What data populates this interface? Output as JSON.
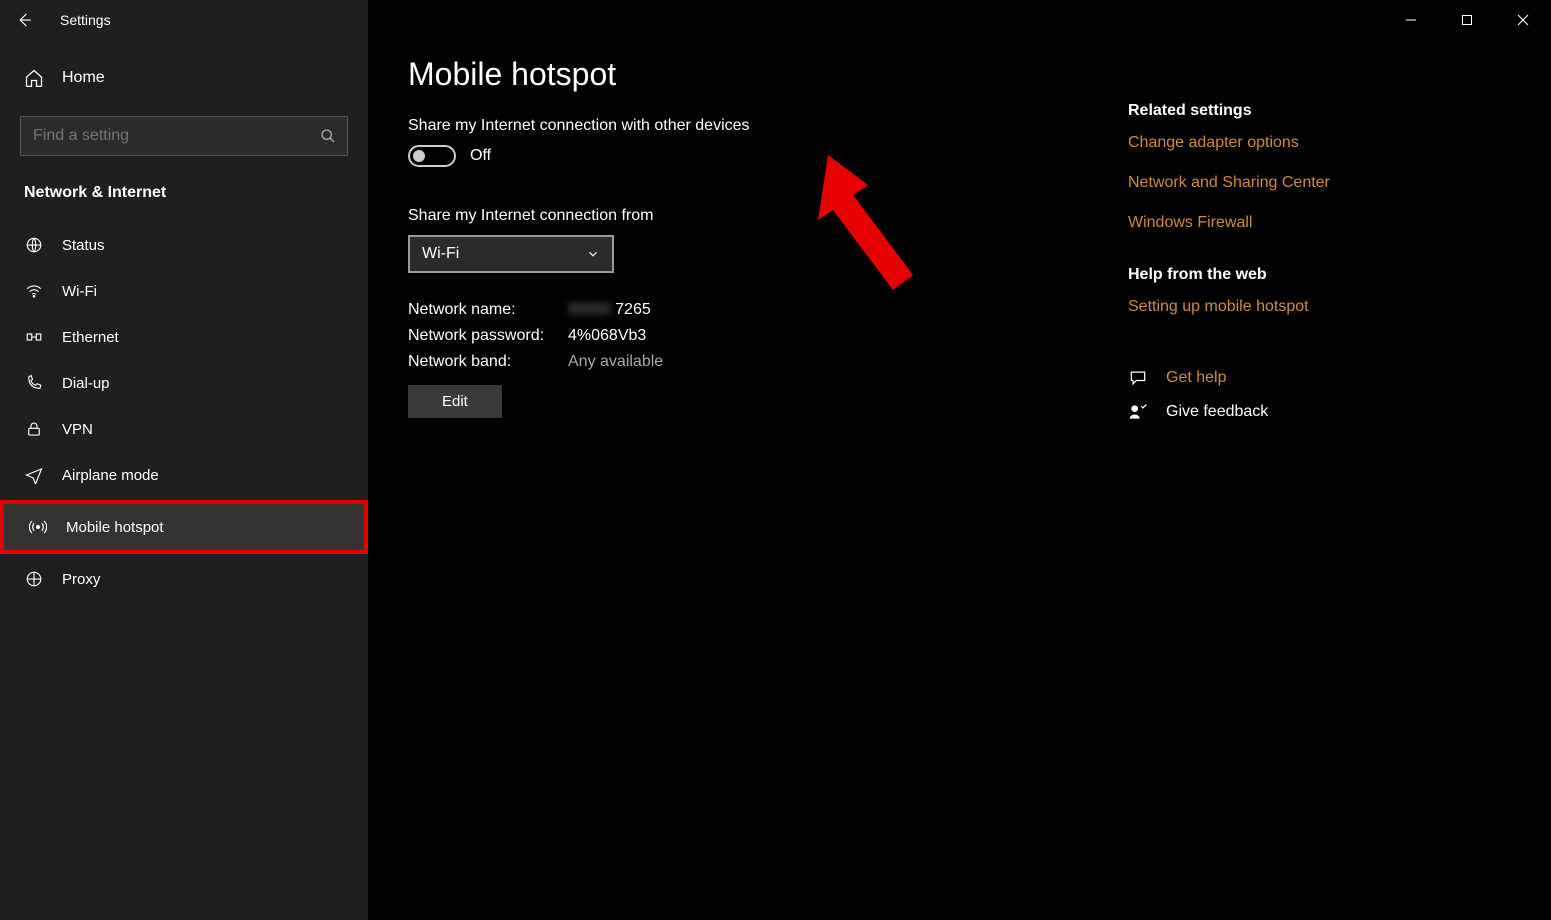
{
  "titlebar": {
    "title": "Settings"
  },
  "sidebar": {
    "home": "Home",
    "search_placeholder": "Find a setting",
    "section": "Network & Internet",
    "items": [
      {
        "label": "Status"
      },
      {
        "label": "Wi-Fi"
      },
      {
        "label": "Ethernet"
      },
      {
        "label": "Dial-up"
      },
      {
        "label": "VPN"
      },
      {
        "label": "Airplane mode"
      },
      {
        "label": "Mobile hotspot"
      },
      {
        "label": "Proxy"
      }
    ]
  },
  "main": {
    "title": "Mobile hotspot",
    "share_label": "Share my Internet connection with other devices",
    "toggle_state": "Off",
    "share_from_label": "Share my Internet connection from",
    "share_from_value": "Wi-Fi",
    "network_name_label": "Network name:",
    "network_name_value": "7265",
    "network_password_label": "Network password:",
    "network_password_value": "4%068Vb3",
    "network_band_label": "Network band:",
    "network_band_value": "Any available",
    "edit_button": "Edit"
  },
  "right": {
    "related_heading": "Related settings",
    "links": [
      "Change adapter options",
      "Network and Sharing Center",
      "Windows Firewall"
    ],
    "help_heading": "Help from the web",
    "help_link": "Setting up mobile hotspot",
    "get_help": "Get help",
    "give_feedback": "Give feedback"
  }
}
